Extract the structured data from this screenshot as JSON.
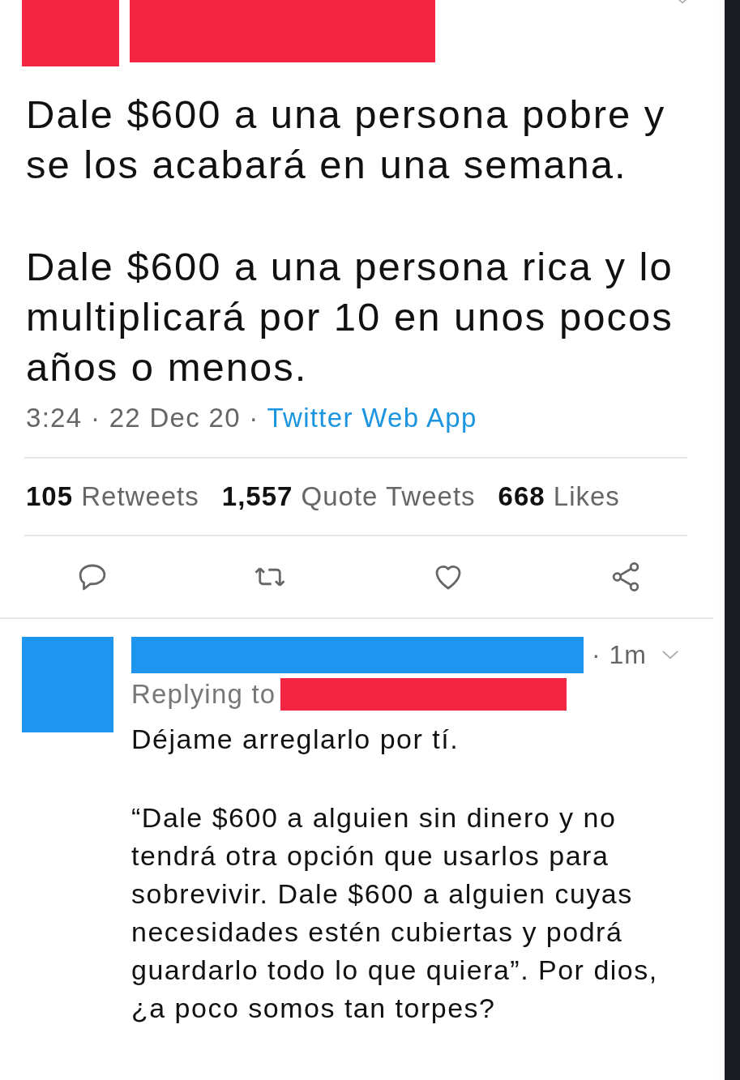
{
  "tweet": {
    "paragraphs": [
      "Dale $600 a una persona pobre y se los acabará en una semana.",
      "Dale $600 a una persona rica y lo multiplicará por 10 en unos pocos años o menos."
    ],
    "time": "3:24 · 22 Dec 20 ·",
    "source": "Twitter Web App",
    "stats": [
      {
        "count": "105",
        "label": "Retweets"
      },
      {
        "count": "1,557",
        "label": "Quote Tweets"
      },
      {
        "count": "668",
        "label": "Likes"
      }
    ]
  },
  "reply": {
    "time": "· 1m",
    "replying_to": "Replying to",
    "paragraphs": [
      "Déjame arreglarlo por tí.",
      "“Dale $600 a alguien sin dinero y no tendrá otra opción que usarlos para sobrevivir. Dale $600 a alguien cuyas necesidades estén cubiertas y podrá guardarlo todo lo que quiera”. Por dios, ¿a poco somos tan torpes?"
    ]
  }
}
